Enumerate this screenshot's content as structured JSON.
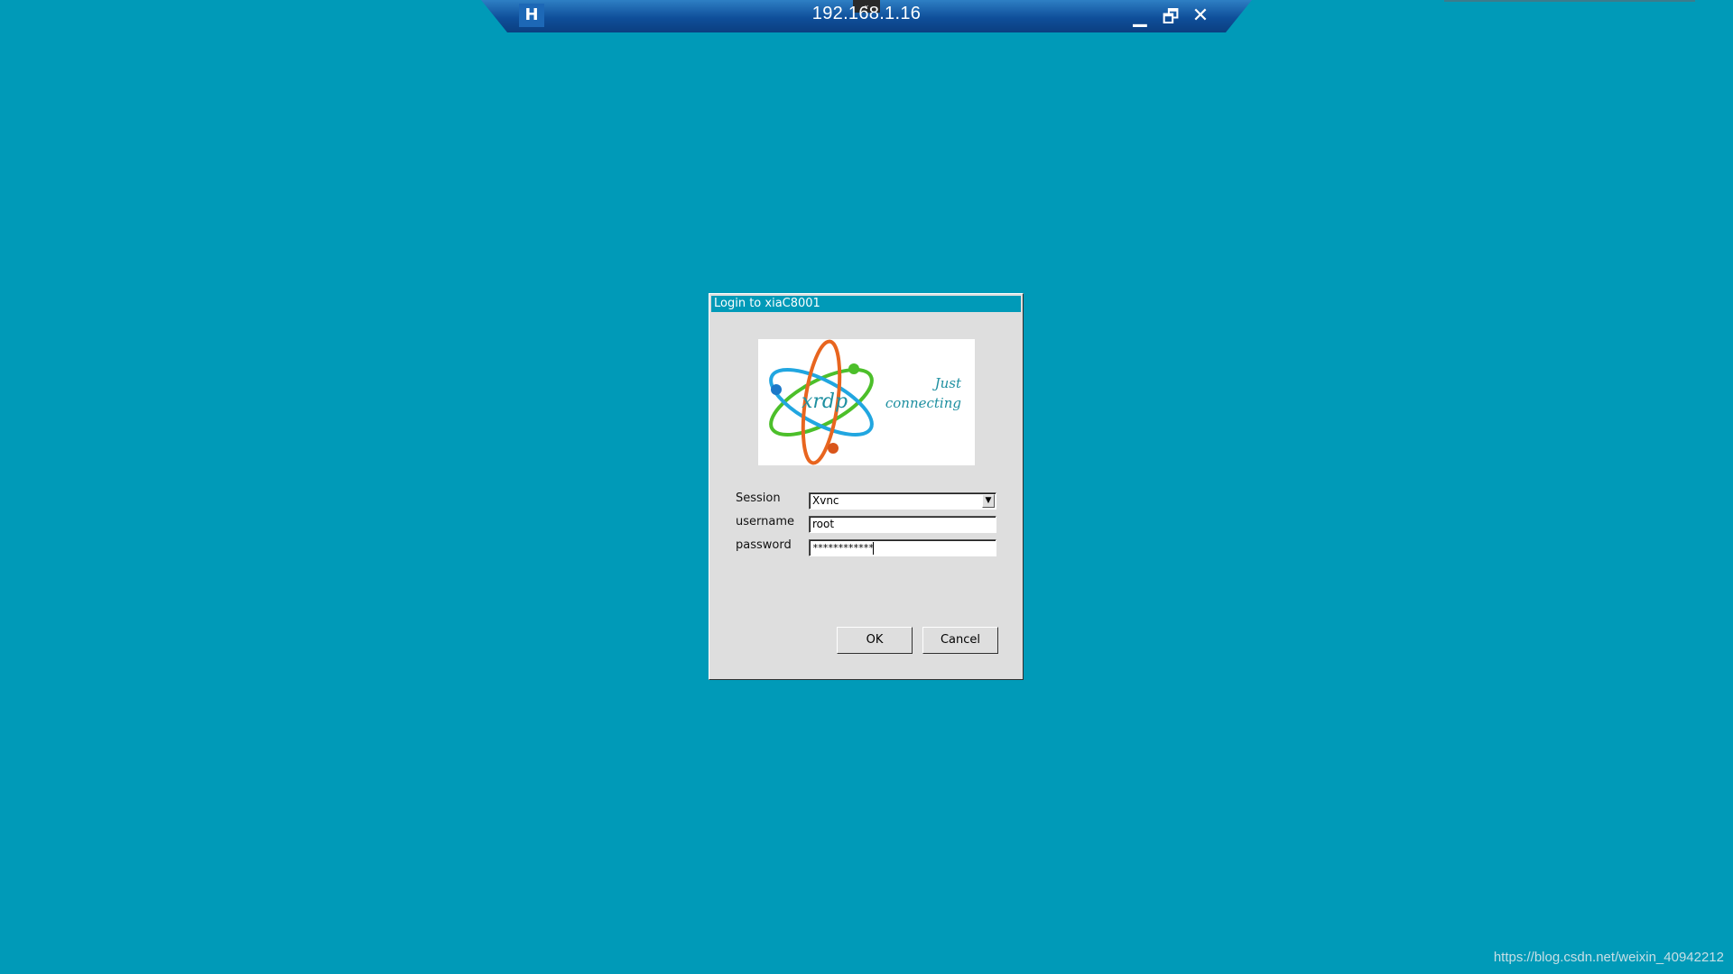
{
  "rdp_bar": {
    "title": "192.168.1.16",
    "pin_glyph": "H",
    "tab_glyph": "⌄",
    "minimize_glyph": "▁",
    "restore_glyph": "🗗",
    "close_glyph": "✕"
  },
  "dialog": {
    "title": "Login to xiaC8001",
    "banner": {
      "logo_text": "xrdp",
      "tagline_line1": "Just",
      "tagline_line2": "connecting"
    },
    "fields": {
      "session_label": "Session",
      "session_value": "Xvnc",
      "username_label": "username",
      "username_value": "root",
      "password_label": "password",
      "password_value": "************"
    },
    "buttons": {
      "ok": "OK",
      "cancel": "Cancel"
    }
  },
  "watermark": "https://blog.csdn.net/weixin_40942212",
  "colors": {
    "desktop_bg": "#009ab8",
    "dialog_bg": "#dedede",
    "dialog_title_bg": "#009ab8",
    "rdp_bar": "#0f4f9a"
  }
}
